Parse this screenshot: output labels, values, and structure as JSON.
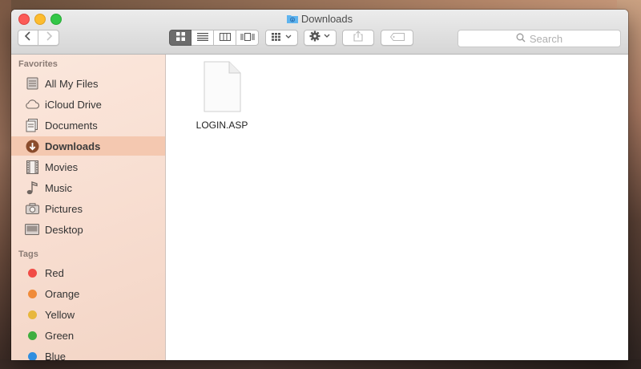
{
  "window": {
    "title": "Downloads"
  },
  "toolbar": {
    "back_icon": "chevron-left-icon",
    "forward_icon": "chevron-right-icon",
    "views": [
      "icon-view",
      "list-view",
      "column-view",
      "coverflow-view"
    ],
    "active_view": "icon-view",
    "search_placeholder": "Search"
  },
  "sidebar": {
    "favorites_heading": "Favorites",
    "favorites": [
      {
        "label": "All My Files",
        "icon": "all-files-icon"
      },
      {
        "label": "iCloud Drive",
        "icon": "cloud-icon"
      },
      {
        "label": "Documents",
        "icon": "documents-icon"
      },
      {
        "label": "Downloads",
        "icon": "download-icon",
        "selected": true
      },
      {
        "label": "Movies",
        "icon": "film-icon"
      },
      {
        "label": "Music",
        "icon": "music-note-icon"
      },
      {
        "label": "Pictures",
        "icon": "camera-icon"
      },
      {
        "label": "Desktop",
        "icon": "desktop-icon"
      }
    ],
    "tags_heading": "Tags",
    "tags": [
      {
        "label": "Red",
        "color": "#f14c46"
      },
      {
        "label": "Orange",
        "color": "#f08b3a"
      },
      {
        "label": "Yellow",
        "color": "#e8b73c"
      },
      {
        "label": "Green",
        "color": "#3fae3f"
      },
      {
        "label": "Blue",
        "color": "#2f8ee0"
      }
    ]
  },
  "files": [
    {
      "name": "LOGIN.ASP",
      "icon": "document-icon"
    }
  ],
  "colors": {
    "selection": "#f4c8b0",
    "close": "#fc5b57",
    "minimize": "#fdbc2e",
    "maximize": "#33c748"
  }
}
